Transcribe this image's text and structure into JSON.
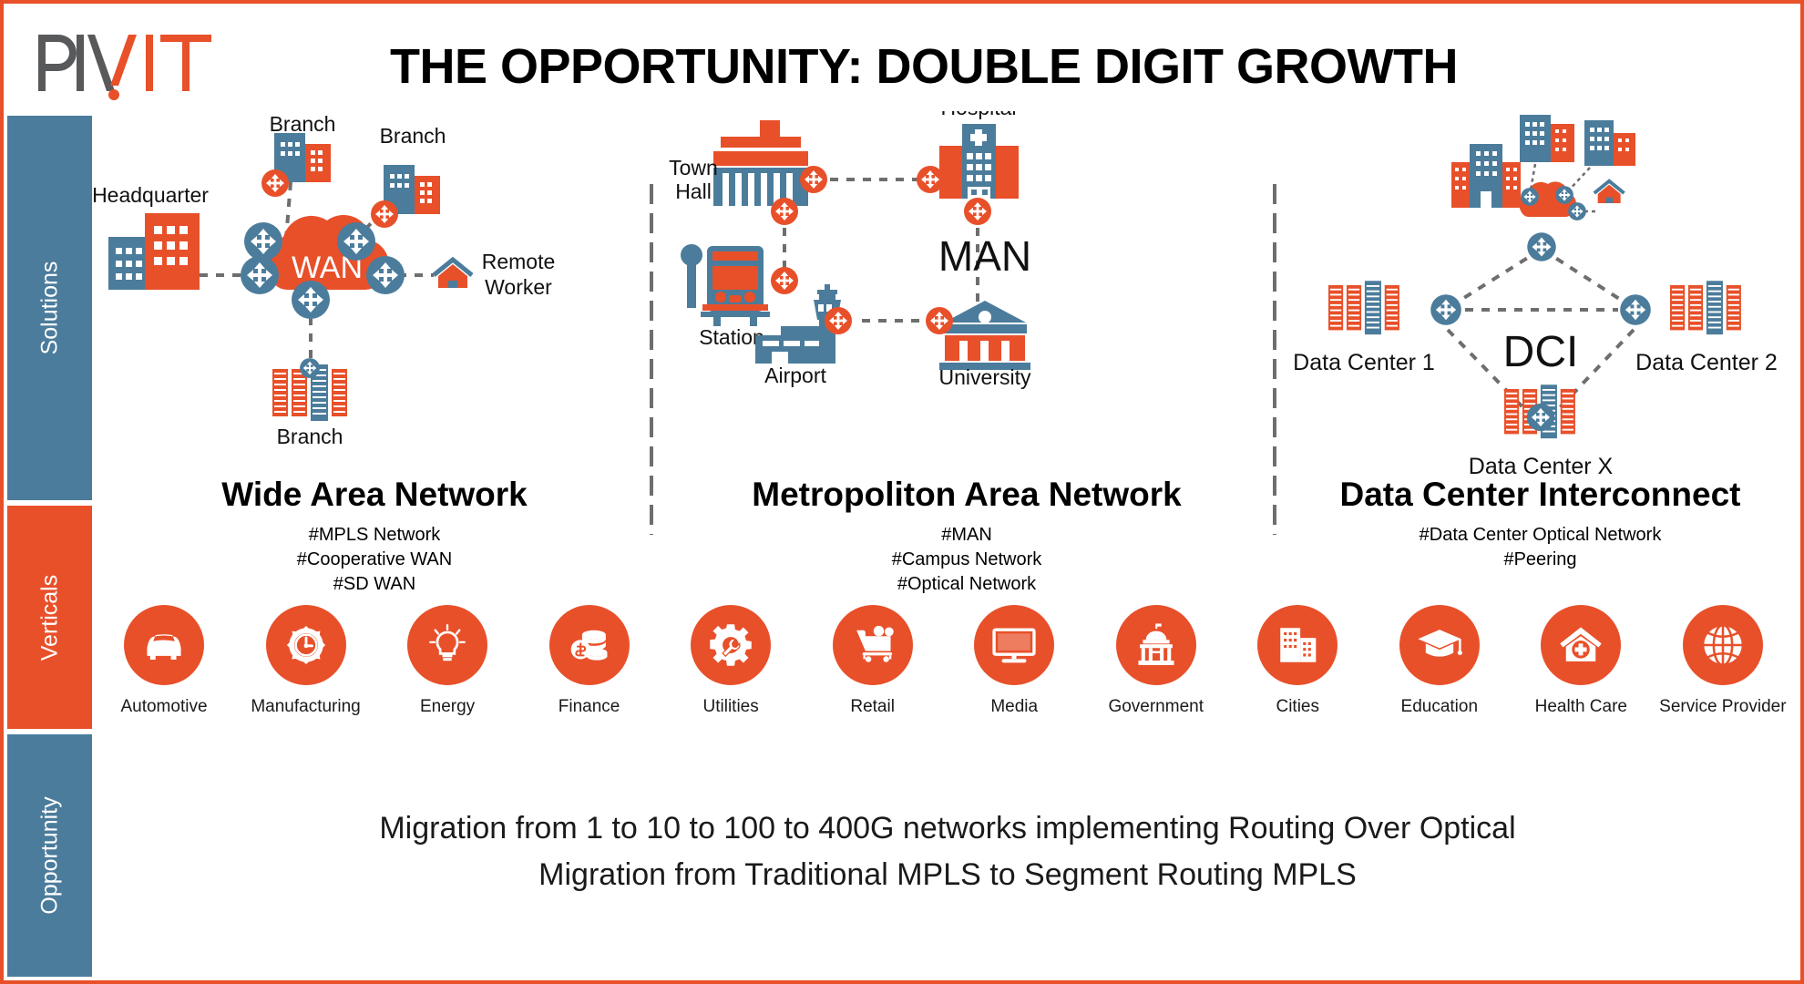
{
  "brand": {
    "logo_text_1": "PIV",
    "logo_text_2": "IT",
    "orange": "#E8502A",
    "blue": "#4B7C9B",
    "dash_gray": "#6E6E6E"
  },
  "header": {
    "title": "THE OPPORTUNITY: DOUBLE DIGIT GROWTH"
  },
  "rail": {
    "items": [
      {
        "label": "Solutions",
        "color": "#4B7C9B"
      },
      {
        "label": "Verticals",
        "color": "#E8502A"
      },
      {
        "label": "Opportunity",
        "color": "#4B7C9B"
      }
    ]
  },
  "panels": [
    {
      "id": "wan",
      "title": "Wide Area Network",
      "tags": "#MPLS Network\n#Cooperative WAN\n#SD WAN",
      "cloud_label": "WAN",
      "nodes": [
        {
          "label": "Headquarter",
          "icon": "office-buildings-icon"
        },
        {
          "label": "Branch",
          "icon": "office-buildings-icon"
        },
        {
          "label": "Branch",
          "icon": "office-buildings-icon"
        },
        {
          "label": "Branch",
          "icon": "server-rack-icon"
        },
        {
          "label": "Remote Worker",
          "icon": "house-icon"
        }
      ]
    },
    {
      "id": "man",
      "title": "Metropoliton Area Network",
      "tags": "#MAN\n#Campus Network\n#Optical Network",
      "cloud_label": "MAN",
      "nodes": [
        {
          "label": "Town Hall",
          "icon": "townhall-icon"
        },
        {
          "label": "Hospital",
          "icon": "hospital-icon"
        },
        {
          "label": "Station",
          "icon": "bus-station-icon"
        },
        {
          "label": "Airport",
          "icon": "airport-icon"
        },
        {
          "label": "University",
          "icon": "university-icon"
        }
      ]
    },
    {
      "id": "dci",
      "title": "Data Center Interconnect",
      "tags": "#Data Center Optical Network\n#Peering",
      "cloud_label": "DCI",
      "nodes": [
        {
          "label": "Data Center 1",
          "icon": "server-rack-icon"
        },
        {
          "label": "Data Center 2",
          "icon": "server-rack-icon"
        },
        {
          "label": "Data Center X",
          "icon": "server-rack-icon"
        }
      ]
    }
  ],
  "verticals": [
    {
      "label": "Automotive",
      "icon": "car-icon"
    },
    {
      "label": "Manufacturing",
      "icon": "gear-clock-icon"
    },
    {
      "label": "Energy",
      "icon": "lightbulb-icon"
    },
    {
      "label": "Finance",
      "icon": "coins-dollar-icon"
    },
    {
      "label": "Utilities",
      "icon": "gear-wrench-icon"
    },
    {
      "label": "Retail",
      "icon": "shopping-cart-icon"
    },
    {
      "label": "Media",
      "icon": "monitor-icon"
    },
    {
      "label": "Government",
      "icon": "capitol-icon"
    },
    {
      "label": "Cities",
      "icon": "city-buildings-icon"
    },
    {
      "label": "Education",
      "icon": "graduation-cap-icon"
    },
    {
      "label": "Health Care",
      "icon": "house-cross-icon"
    },
    {
      "label": "Service Provider",
      "icon": "globe-icon"
    }
  ],
  "footer": {
    "line1": "Migration from 1 to 10 to 100 to 400G networks implementing Routing Over Optical",
    "line2": "Migration from Traditional MPLS to Segment Routing MPLS"
  }
}
